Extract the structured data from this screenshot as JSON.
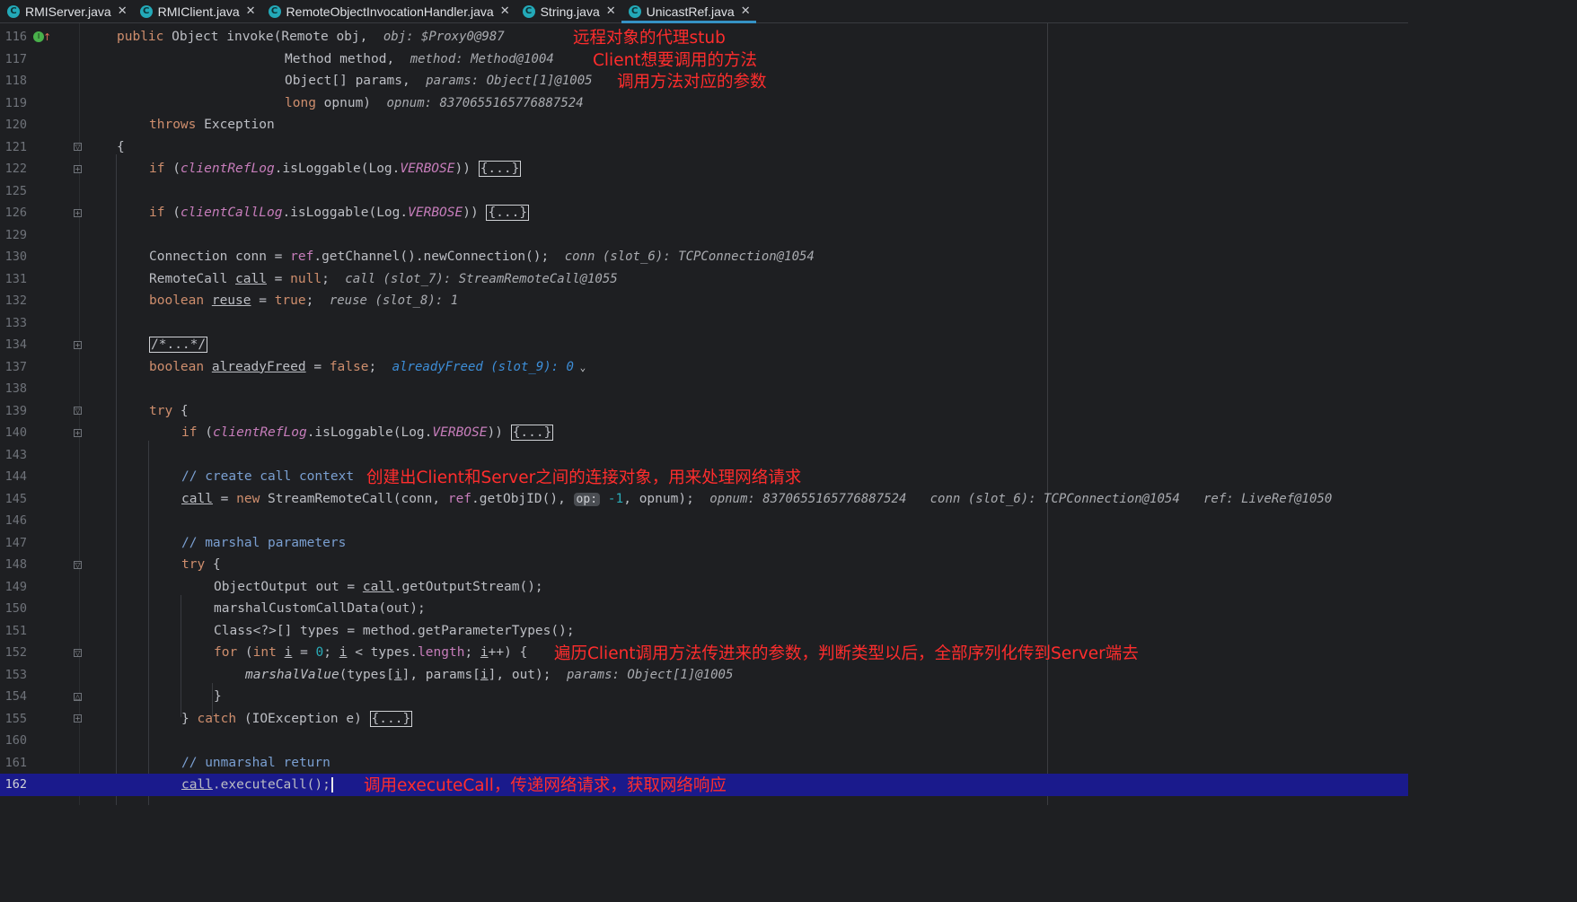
{
  "tabs": [
    {
      "label": "RMIServer.java",
      "icon": "class-icon",
      "active": false
    },
    {
      "label": "RMIClient.java",
      "icon": "class-icon",
      "active": false
    },
    {
      "label": "RemoteObjectInvocationHandler.java",
      "icon": "class-icon",
      "active": false
    },
    {
      "label": "String.java",
      "icon": "class-icon",
      "active": false
    },
    {
      "label": "UnicastRef.java",
      "icon": "class-icon",
      "active": true
    }
  ],
  "lines": {
    "l116": "116",
    "l117": "117",
    "l118": "118",
    "l119": "119",
    "l120": "120",
    "l121": "121",
    "l122": "122",
    "l125": "125",
    "l126": "126",
    "l129": "129",
    "l130": "130",
    "l131": "131",
    "l132": "132",
    "l133": "133",
    "l134": "134",
    "l137": "137",
    "l138": "138",
    "l139": "139",
    "l140": "140",
    "l143": "143",
    "l144": "144",
    "l145": "145",
    "l146": "146",
    "l147": "147",
    "l148": "148",
    "l149": "149",
    "l150": "150",
    "l151": "151",
    "l152": "152",
    "l153": "153",
    "l154": "154",
    "l155": "155",
    "l160": "160",
    "l161": "161",
    "l162": "162"
  },
  "hints": {
    "obj": "obj: $Proxy0@987",
    "method": "method: Method@1004",
    "params": "params: Object[1]@1005",
    "opnum": "opnum: 8370655165776887524",
    "conn": "conn (slot_6): TCPConnection@1054",
    "call": "call (slot_7): StreamRemoteCall@1055",
    "reuse": "reuse (slot_8): 1",
    "alreadyFreed": "alreadyFreed (slot_9): 0",
    "opnum2": "opnum: 8370655165776887524",
    "conn2": "conn (slot_6): TCPConnection@1054",
    "ref": "ref: LiveRef@1050",
    "params2": "params: Object[1]@1005"
  },
  "annotations": {
    "a116": "远程对象的代理stub",
    "a117": "Client想要调用的方法",
    "a118": "调用方法对应的参数",
    "a144": "创建出Client和Server之间的连接对象，用来处理网络请求",
    "a152": "遍历Client调用方法传进来的参数，判断类型以后，全部序列化传到Server端去",
    "a162": "调用executeCall，传递网络请求，获取网络响应"
  },
  "colors": {
    "background": "#1e1f22",
    "keyword": "#cf8e6d",
    "field": "#c77dbb",
    "comment": "#7a9fd1",
    "current_line": "#1a1a8c",
    "annotation": "#ff2d2d",
    "tab_accent": "#3592c4"
  }
}
